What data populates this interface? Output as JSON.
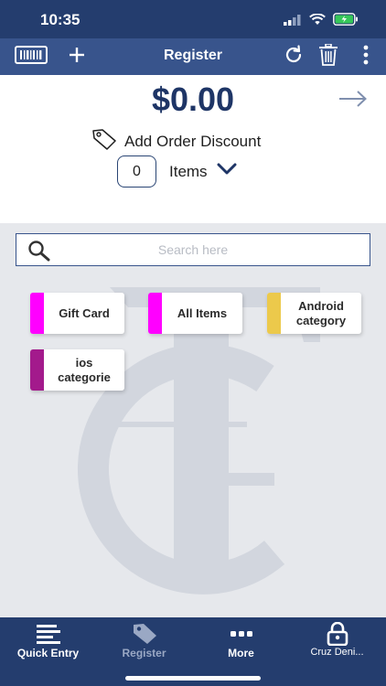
{
  "status_bar": {
    "time": "10:35"
  },
  "toolbar": {
    "title": "Register"
  },
  "summary": {
    "total": "$0.00",
    "discount_label": "Add Order Discount",
    "items_count": "0",
    "items_label": "Items"
  },
  "search": {
    "placeholder": "Search here"
  },
  "categories": [
    {
      "label": "Gift Card",
      "color": "#ff00ff"
    },
    {
      "label": "All Items",
      "color": "#ff00ff"
    },
    {
      "label": "Android category",
      "color": "#ecc94b"
    },
    {
      "label": "ios categorie",
      "color": "#a31a8c"
    }
  ],
  "tabs": [
    {
      "label": "Quick Entry",
      "icon": "list-icon"
    },
    {
      "label": "Register",
      "icon": "tag-icon"
    },
    {
      "label": "More",
      "icon": "more-dots-icon"
    },
    {
      "label": "Cruz Deni...",
      "icon": "lock-icon"
    }
  ],
  "colors": {
    "primary": "#38548c",
    "dark": "#243d6e",
    "total_text": "#1e3566"
  }
}
